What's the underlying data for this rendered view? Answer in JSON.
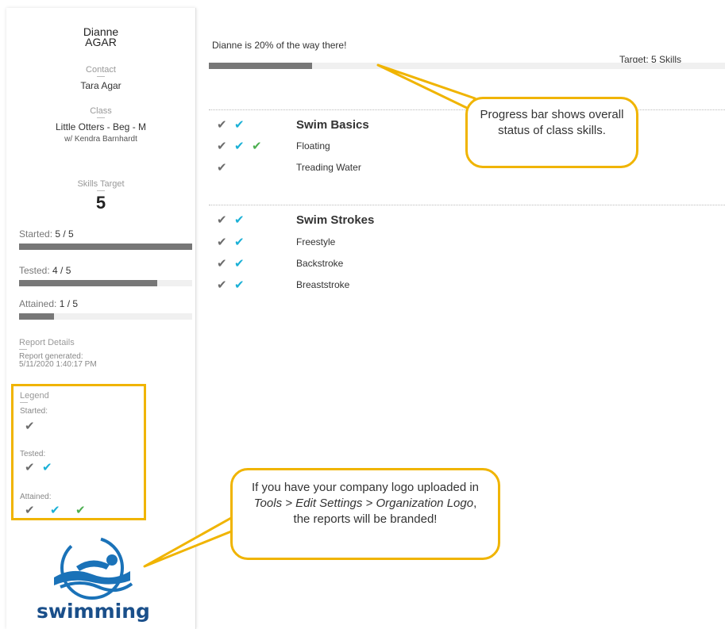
{
  "student": {
    "first_name": "Dianne",
    "last_name": "AGAR",
    "contact_label": "Contact",
    "contact_name": "Tara Agar",
    "class_label": "Class",
    "class_name": "Little Otters - Beg - M",
    "instructor": "w/ Kendra Barnhardt",
    "skills_target_label": "Skills Target",
    "skills_target_value": "5"
  },
  "stats": [
    {
      "label": "Started:",
      "value": "5 / 5",
      "fraction": 1.0
    },
    {
      "label": "Tested:",
      "value": "4 / 5",
      "fraction": 0.8
    },
    {
      "label": "Attained:",
      "value": "1 / 5",
      "fraction": 0.2
    }
  ],
  "report": {
    "details_label": "Report Details",
    "generated_label": "Report generated:",
    "generated_value": "5/11/2020 1:40:17 PM"
  },
  "legend": {
    "title": "Legend",
    "started_label": "Started:",
    "tested_label": "Tested:",
    "attained_label": "Attained:"
  },
  "logo": {
    "text": "swimming",
    "icon": "swimmer-logo-icon"
  },
  "progress": {
    "message": "Dianne is 20% of the way there!",
    "target": "Target: 5 Skills",
    "fraction": 0.2
  },
  "sections": [
    {
      "title": "Swim Basics",
      "title_checks": [
        "gray",
        "teal"
      ],
      "skills": [
        {
          "name": "Floating",
          "checks": [
            "gray",
            "teal",
            "green"
          ]
        },
        {
          "name": "Treading Water",
          "checks": [
            "gray"
          ]
        }
      ]
    },
    {
      "title": "Swim Strokes",
      "title_checks": [
        "gray",
        "teal"
      ],
      "skills": [
        {
          "name": "Freestyle",
          "checks": [
            "gray",
            "teal"
          ]
        },
        {
          "name": "Backstroke",
          "checks": [
            "gray",
            "teal"
          ]
        },
        {
          "name": "Breaststroke",
          "checks": [
            "gray",
            "teal"
          ]
        }
      ]
    }
  ],
  "callouts": {
    "progress": "Progress bar shows overall status of class skills.",
    "logo_line1": "If you have your company logo uploaded in",
    "logo_italic": "Tools > Edit Settings > Organization Logo",
    "logo_line2": ", the reports will be branded!"
  },
  "colors": {
    "gray_check": "#6d6d6d",
    "teal_check": "#1ab0d6",
    "green_check": "#4caf50",
    "callout_border": "#f0b400",
    "bar_fill": "#777777"
  }
}
